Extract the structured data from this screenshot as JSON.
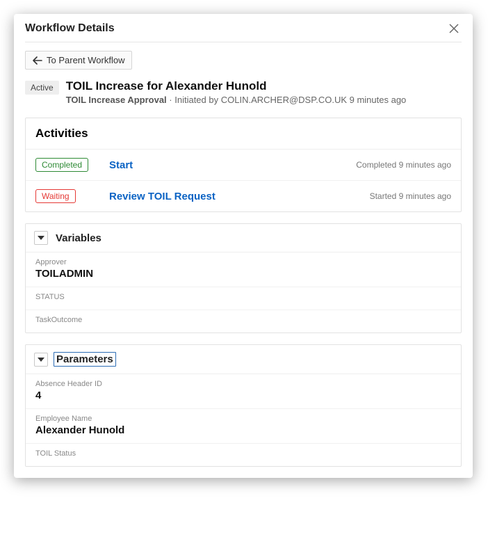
{
  "modal": {
    "title": "Workflow Details"
  },
  "parentButton": {
    "label": "To Parent Workflow"
  },
  "workflow": {
    "statusBadge": "Active",
    "title": "TOIL Increase for Alexander Hunold",
    "subtitleName": "TOIL Increase Approval",
    "subtitleSep": " · ",
    "initiatedPrefix": "Initiated by ",
    "initiatedBy": "COLIN.ARCHER@DSP.CO.UK",
    "initiatedWhen": " 9 minutes ago"
  },
  "activities": {
    "heading": "Activities",
    "rows": [
      {
        "status": "Completed",
        "statusClass": "completed",
        "name": "Start",
        "meta": "Completed 9 minutes ago"
      },
      {
        "status": "Waiting",
        "statusClass": "waiting",
        "name": "Review TOIL Request",
        "meta": "Started 9 minutes ago"
      }
    ]
  },
  "variables": {
    "heading": "Variables",
    "items": [
      {
        "label": "Approver",
        "value": "TOILADMIN"
      },
      {
        "label": "STATUS",
        "value": ""
      },
      {
        "label": "TaskOutcome",
        "value": ""
      }
    ]
  },
  "parameters": {
    "heading": "Parameters",
    "items": [
      {
        "label": "Absence Header ID",
        "value": "4"
      },
      {
        "label": "Employee Name",
        "value": "Alexander Hunold"
      },
      {
        "label": "TOIL Status",
        "value": ""
      }
    ]
  }
}
